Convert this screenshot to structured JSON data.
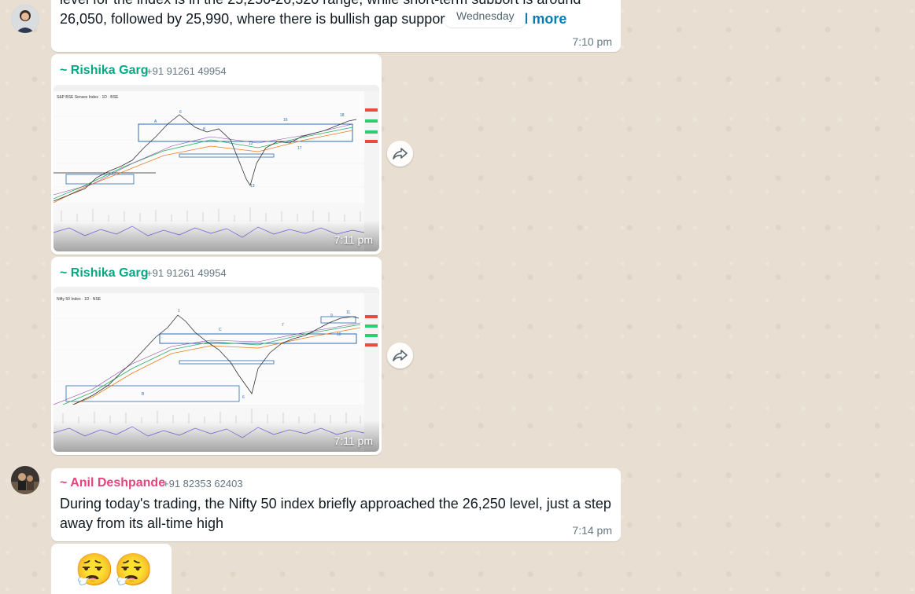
{
  "date_pill": "Wednesday",
  "messages": [
    {
      "text_line1": "level for the index is in the 25,250-26,320 range, while short-term support is around",
      "text_line2": "26,050, followed by 25,990, where there is bullish gap support in th…",
      "read_more": "Read more",
      "time": "7:10 pm"
    },
    {
      "sender": "~ Rishika Garg",
      "phone": "+91 91261 49954",
      "time": "7:11 pm",
      "image_title": "S&P BSE Sensex Index · 1D · BSE"
    },
    {
      "sender": "~ Rishika Garg",
      "phone": "+91 91261 49954",
      "time": "7:11 pm",
      "image_title": "Nifty 50 Index · 1D · NSE"
    },
    {
      "sender": "~ Anil Deshpande",
      "phone": "+91 82353 62403",
      "text_line1": "During today's trading, the Nifty 50 index briefly approached the 26,250 level, just a step",
      "text_line2": "away from its all-time high",
      "time": "7:14 pm"
    },
    {
      "emoji": "😮‍💨😮‍💨"
    }
  ],
  "colors": {
    "rishika": "#06a884",
    "anil": "#e5447a",
    "link": "#027eb5"
  }
}
